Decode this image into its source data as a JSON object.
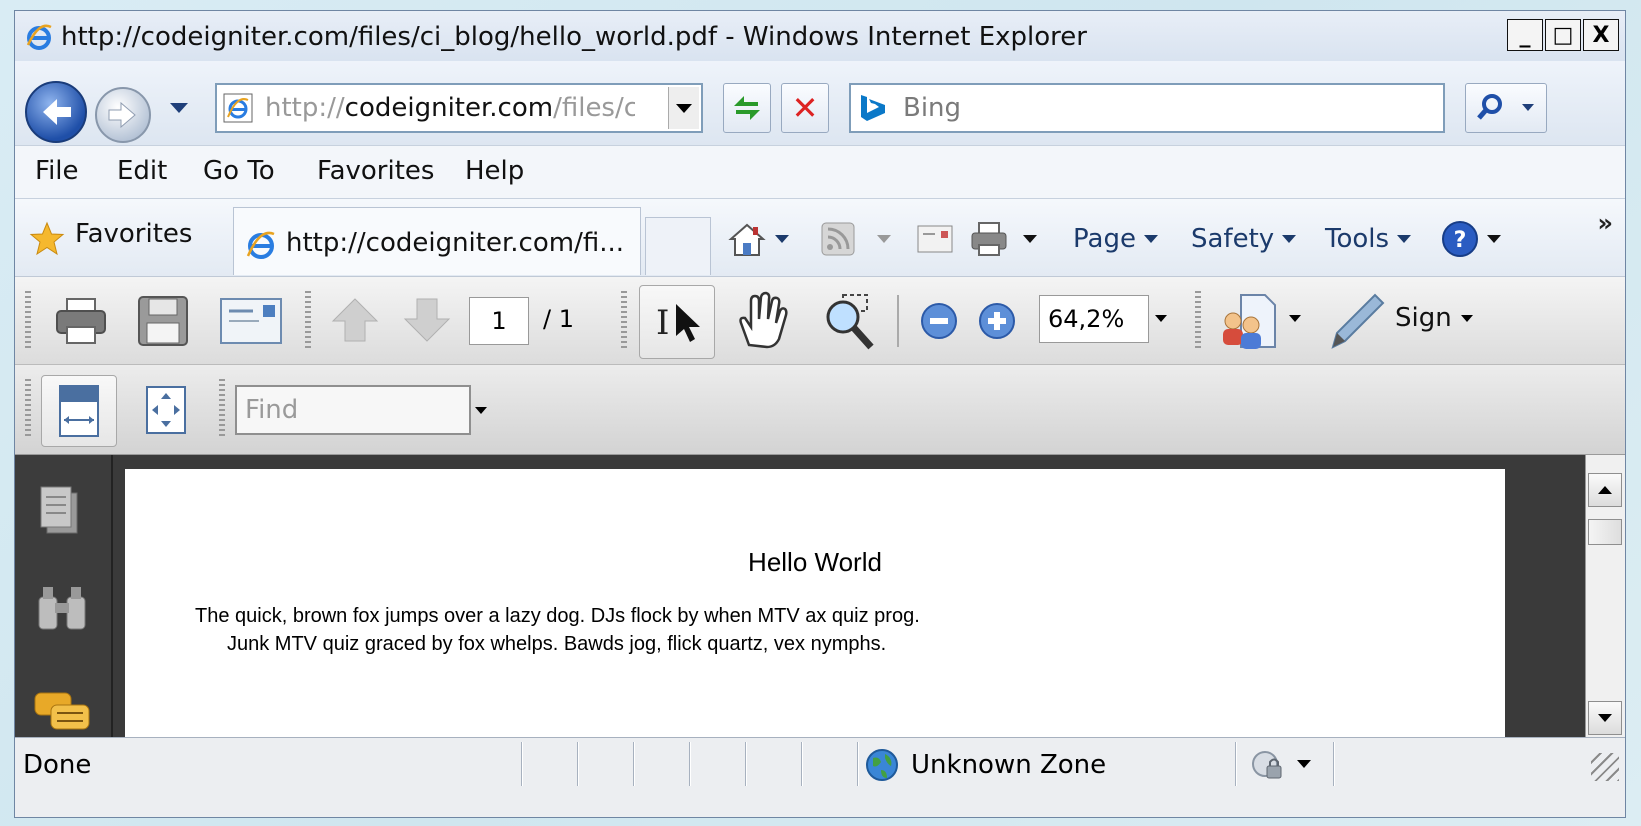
{
  "window": {
    "title": "http://codeigniter.com/files/ci_blog/hello_world.pdf - Windows Internet Explorer",
    "min_label": "_",
    "max_label": "□",
    "close_label": "X"
  },
  "address_bar": {
    "prefix": "http://",
    "domain": "codeigniter.com",
    "path": "/files/ci_blog/hello_world.pdf"
  },
  "search": {
    "placeholder": "Bing"
  },
  "menu": [
    "File",
    "Edit",
    "Go To",
    "Favorites",
    "Help"
  ],
  "favorites_bar": {
    "favorites_label": "Favorites",
    "tab_title": "http://codeigniter.com/fi...",
    "commands": {
      "page": "Page",
      "safety": "Safety",
      "tools": "Tools"
    },
    "more": "»"
  },
  "reader_toolbar": {
    "page_current": "1",
    "page_total": "/ 1",
    "zoom": "64,2%",
    "sign_label": "Sign",
    "find_placeholder": "Find"
  },
  "document": {
    "title": "Hello World",
    "lines": [
      "The quick, brown fox jumps over a lazy dog. DJs flock by when MTV ax quiz prog.",
      "Junk MTV quiz graced by fox whelps. Bawds jog, flick quartz, vex nymphs."
    ]
  },
  "status_bar": {
    "status": "Done",
    "zone": "Unknown Zone"
  },
  "icons": {
    "back": "back-arrow-icon",
    "forward": "forward-arrow-icon",
    "refresh": "refresh-icon",
    "stop": "stop-icon",
    "search": "search-icon",
    "home": "home-icon",
    "feeds": "rss-icon",
    "mail": "mail-icon",
    "print": "print-icon",
    "help": "help-icon",
    "save": "save-icon",
    "email": "email-icon",
    "prev_page": "up-arrow-icon",
    "next_page": "down-arrow-icon",
    "select": "select-tool-icon",
    "hand": "hand-tool-icon",
    "marquee_zoom": "marquee-zoom-icon",
    "zoom_out": "zoom-out-icon",
    "zoom_in": "zoom-in-icon",
    "collaborate": "collaborate-icon",
    "sign": "pen-icon",
    "fit_width": "fit-width-icon",
    "fit_page": "fit-page-icon",
    "pages_panel": "pages-icon",
    "search_panel": "binoculars-icon",
    "comments_panel": "comments-icon",
    "globe": "globe-icon",
    "protected_mode": "protected-mode-icon"
  },
  "colors": {
    "ie_blue": "#1f4fa8",
    "link_blue": "#1b3a6b",
    "stop_red": "#d22222",
    "reader_dark": "#3a3a3a"
  }
}
